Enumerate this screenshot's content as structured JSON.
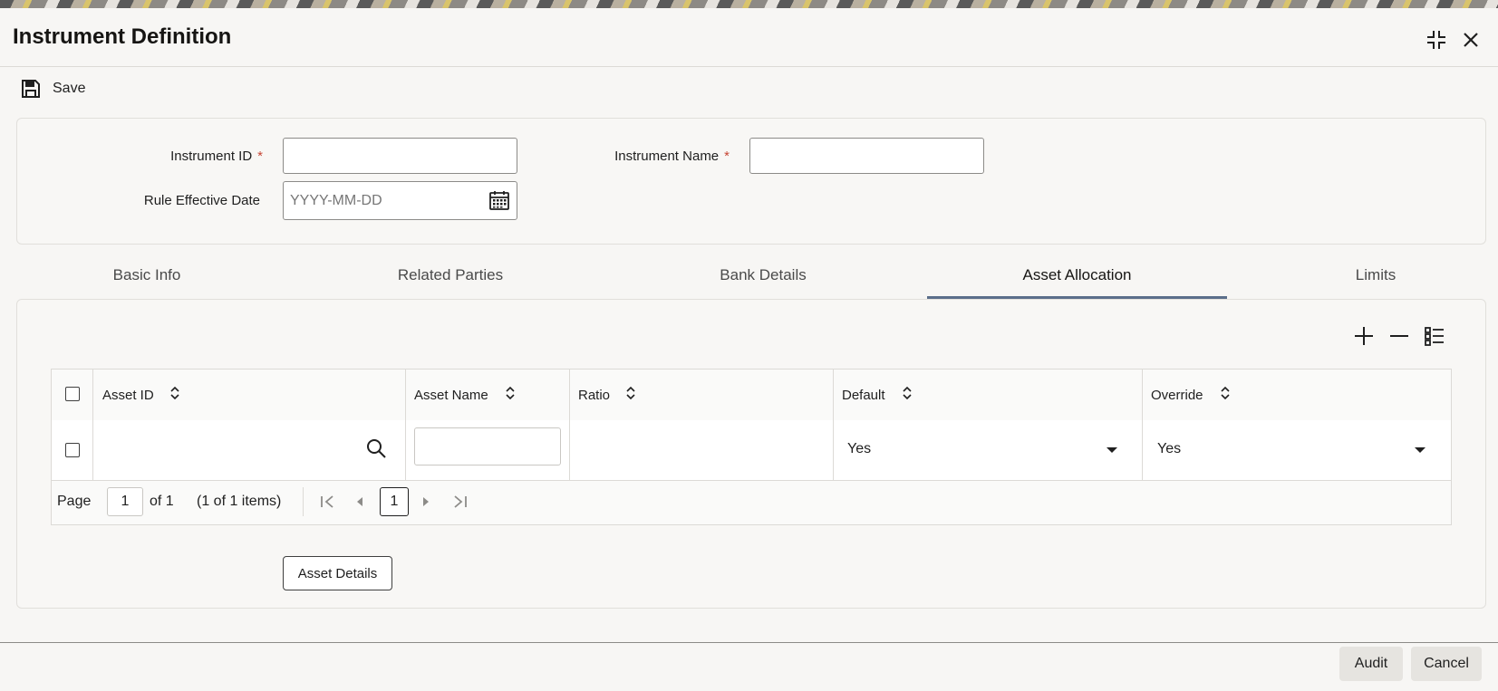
{
  "window": {
    "title": "Instrument Definition"
  },
  "toolbar": {
    "save_label": "Save"
  },
  "header": {
    "instrument_id_label": "Instrument ID",
    "instrument_id_value": "",
    "instrument_name_label": "Instrument Name",
    "instrument_name_value": "",
    "rule_effective_date_label": "Rule Effective Date",
    "rule_effective_date_placeholder": "YYYY-MM-DD",
    "required_mark": "*"
  },
  "tabs": [
    {
      "label": "Basic Info",
      "active": false
    },
    {
      "label": "Related Parties",
      "active": false
    },
    {
      "label": "Bank Details",
      "active": false
    },
    {
      "label": "Asset Allocation",
      "active": true
    },
    {
      "label": "Limits",
      "active": false
    }
  ],
  "grid": {
    "columns": [
      "Asset ID",
      "Asset Name",
      "Ratio",
      "Default",
      "Override"
    ],
    "rows": [
      {
        "asset_id": "",
        "asset_name": "",
        "ratio": "",
        "default": "Yes",
        "override": "Yes"
      }
    ],
    "pager": {
      "page_label": "Page",
      "page_value": "1",
      "of_label": "of 1",
      "items_label": "(1 of 1 items)",
      "current_page": "1"
    }
  },
  "buttons": {
    "asset_details": "Asset Details"
  },
  "footer": {
    "audit_label": "Audit",
    "cancel_label": "Cancel"
  },
  "colors": {
    "required": "#c74634",
    "active_tab_underline": "#5b6e8a"
  }
}
